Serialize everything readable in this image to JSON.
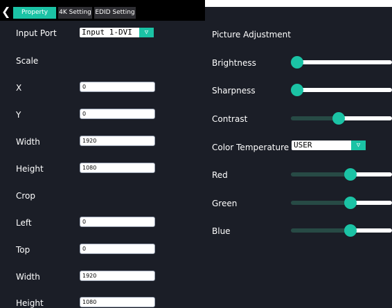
{
  "tabs": [
    {
      "label": "Property",
      "active": true
    },
    {
      "label": "4K Setting",
      "active": false
    },
    {
      "label": "EDID Setting",
      "active": false
    }
  ],
  "left": {
    "input_port_label": "Input Port",
    "input_port_value": "Input 1-DVI",
    "scale_heading": "Scale",
    "x_label": "X",
    "x_value": "0",
    "y_label": "Y",
    "y_value": "0",
    "width_label": "Width",
    "width_value": "1920",
    "height_label": "Height",
    "height_value": "1080",
    "crop_heading": "Crop",
    "left_label": "Left",
    "left_value": "0",
    "top_label": "Top",
    "top_value": "0",
    "crop_width_label": "Width",
    "crop_width_value": "1920",
    "crop_height_label": "Height",
    "crop_height_value": "1080"
  },
  "right": {
    "heading": "Picture Adjustment",
    "brightness_label": "Brightness",
    "sharpness_label": "Sharpness",
    "contrast_label": "Contrast",
    "color_temp_label": "Color Temperature",
    "color_temp_value": "USER",
    "red_label": "Red",
    "green_label": "Green",
    "blue_label": "Blue"
  },
  "sliders": {
    "brightness": 0.0,
    "sharpness": 0.0,
    "contrast": 0.44,
    "red": 0.56,
    "green": 0.56,
    "blue": 0.56
  },
  "colors": {
    "accent": "#1bc3a5",
    "background": "#1b1e27",
    "tab_inactive": "#2e2e33"
  }
}
